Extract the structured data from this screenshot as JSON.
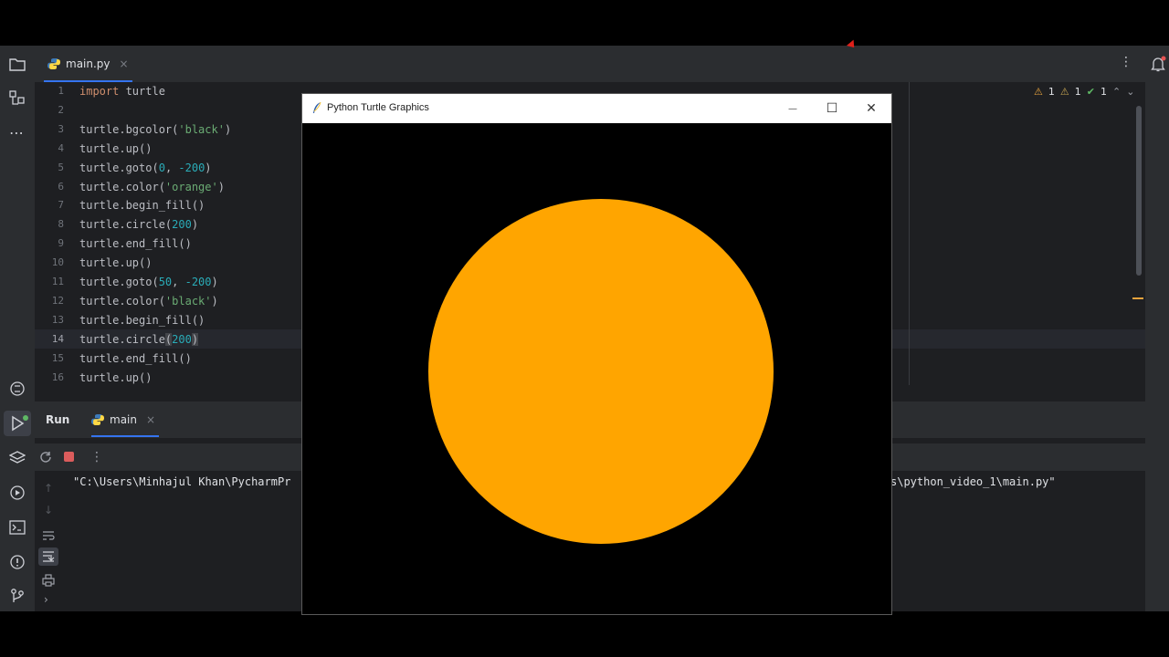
{
  "editor": {
    "tab_label": "main.py",
    "tab_close": "×",
    "inspection": {
      "warn1": "1",
      "warn2": "1",
      "ok": "1"
    },
    "line_numbers": [
      "1",
      "2",
      "3",
      "4",
      "5",
      "6",
      "7",
      "8",
      "9",
      "10",
      "11",
      "12",
      "13",
      "14",
      "15",
      "16"
    ],
    "current_line": "14"
  },
  "run": {
    "run_label": "Run",
    "config_label": "main",
    "close": "×",
    "cmd_left": "\"C:\\Users\\Minhajul Khan\\PycharmPr",
    "cmd_right": "s\\python_video_1\\main.py\""
  },
  "turtle_window": {
    "title": "Python Turtle Graphics",
    "minimize": "—",
    "maximize": "☐",
    "close": "✕",
    "background": "black",
    "circle_color": "#ffa500"
  },
  "colors": {
    "ide_bg": "#1e1f22",
    "panel_bg": "#2b2d30",
    "accent": "#3574f0"
  }
}
